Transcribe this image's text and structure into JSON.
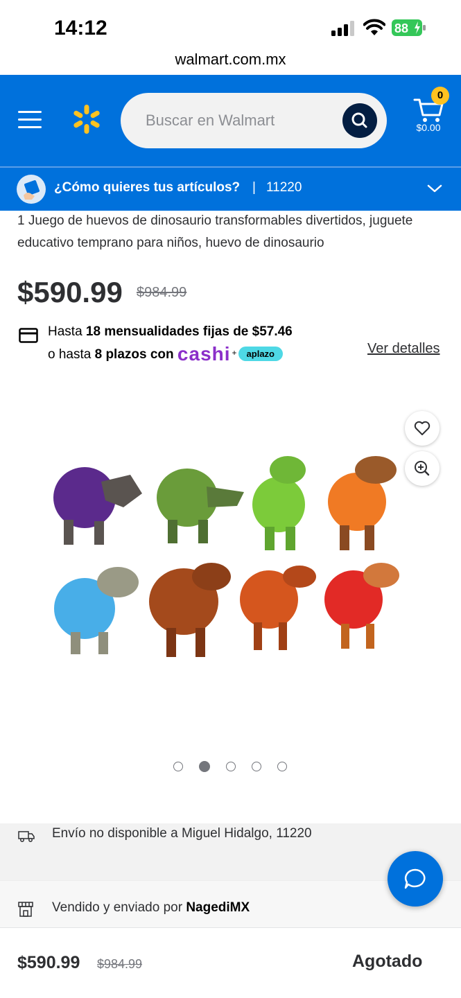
{
  "status_bar": {
    "time": "14:12",
    "battery": "88"
  },
  "browser": {
    "url": "walmart.com.mx"
  },
  "header": {
    "menu_icon": "hamburger-menu-icon",
    "logo_icon": "walmart-spark-icon",
    "search_placeholder": "Buscar en Walmart",
    "search_icon": "search-icon",
    "cart_icon": "cart-icon",
    "cart_count": "0",
    "cart_total": "$0.00",
    "brand_color": "#0071dc",
    "spark_color": "#ffc220"
  },
  "delivery": {
    "prompt": "¿Cómo quieres tus artículos?",
    "separator": "|",
    "zip": "11220",
    "chevron_icon": "chevron-down-icon"
  },
  "product": {
    "title": "1 Juego de huevos de dinosaurio transformables divertidos, juguete educativo temprano para niños, huevo de dinosaurio",
    "price": "$590.99",
    "old_price": "$984.99",
    "installments": {
      "line1_prefix": "Hasta ",
      "line1_bold": "18 mensualidades fijas de $57.46",
      "line2_prefix": "o hasta ",
      "line2_bold": "8 plazos con",
      "cashi_logo": "cashi",
      "plus": "+",
      "aplazo_logo": "aplazo",
      "details_link": "Ver detalles"
    },
    "image_alt": "Set of 8 transformable dinosaur egg toys",
    "favorite_icon": "heart-icon",
    "zoom_icon": "zoom-in-icon",
    "carousel": {
      "total": 5,
      "active_index": 1
    }
  },
  "shipping": {
    "icon": "truck-icon",
    "text": "Envío no disponible a Miguel Hidalgo, 11220"
  },
  "seller": {
    "icon": "store-icon",
    "prefix": "Vendido y enviado por ",
    "name": "NagediMX"
  },
  "chat": {
    "icon": "chat-bubble-icon"
  },
  "bottom_bar": {
    "price": "$590.99",
    "old_price": "$984.99",
    "status": "Agotado"
  }
}
